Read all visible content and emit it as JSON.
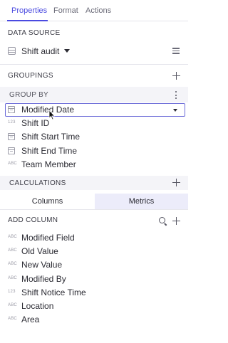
{
  "tabs": [
    {
      "label": "Properties",
      "active": true
    },
    {
      "label": "Format",
      "active": false
    },
    {
      "label": "Actions",
      "active": false
    }
  ],
  "data_source": {
    "label": "DATA SOURCE",
    "name": "Shift audit",
    "icon": "table-icon",
    "view_icon": "list-icon"
  },
  "groupings": {
    "label": "GROUPINGS",
    "add_icon": "plus-icon"
  },
  "group_by": {
    "label": "GROUP BY",
    "menu_icon": "kebab-icon",
    "fields": [
      {
        "type": "date",
        "type_icon": "calendar-icon",
        "label": "Modified Date",
        "selected": true
      },
      {
        "type": "number",
        "type_icon": "123",
        "label": "Shift ID"
      },
      {
        "type": "date",
        "type_icon": "calendar-icon",
        "label": "Shift Start Time"
      },
      {
        "type": "date",
        "type_icon": "calendar-icon",
        "label": "Shift End Time"
      },
      {
        "type": "text",
        "type_icon": "ABC",
        "label": "Team Member"
      }
    ]
  },
  "calculations": {
    "label": "CALCULATIONS",
    "add_icon": "plus-icon"
  },
  "segmented": {
    "options": [
      "Columns",
      "Metrics"
    ],
    "active": "Columns"
  },
  "add_column": {
    "label": "ADD COLUMN",
    "search_icon": "search-icon",
    "add_icon": "plus-icon",
    "fields": [
      {
        "type_icon": "ABC",
        "label": "Modified Field"
      },
      {
        "type_icon": "ABC",
        "label": "Old Value"
      },
      {
        "type_icon": "ABC",
        "label": "New Value"
      },
      {
        "type_icon": "ABC",
        "label": "Modified By"
      },
      {
        "type_icon": "123",
        "label": "Shift Notice Time"
      },
      {
        "type_icon": "ABC",
        "label": "Location"
      },
      {
        "type_icon": "ABC",
        "label": "Area"
      }
    ]
  },
  "colors": {
    "accent": "#4a4ae0",
    "selection_border": "#6b6bd8",
    "header_bg": "#f4f4f8",
    "segment_active_bg": "#ececfa"
  }
}
